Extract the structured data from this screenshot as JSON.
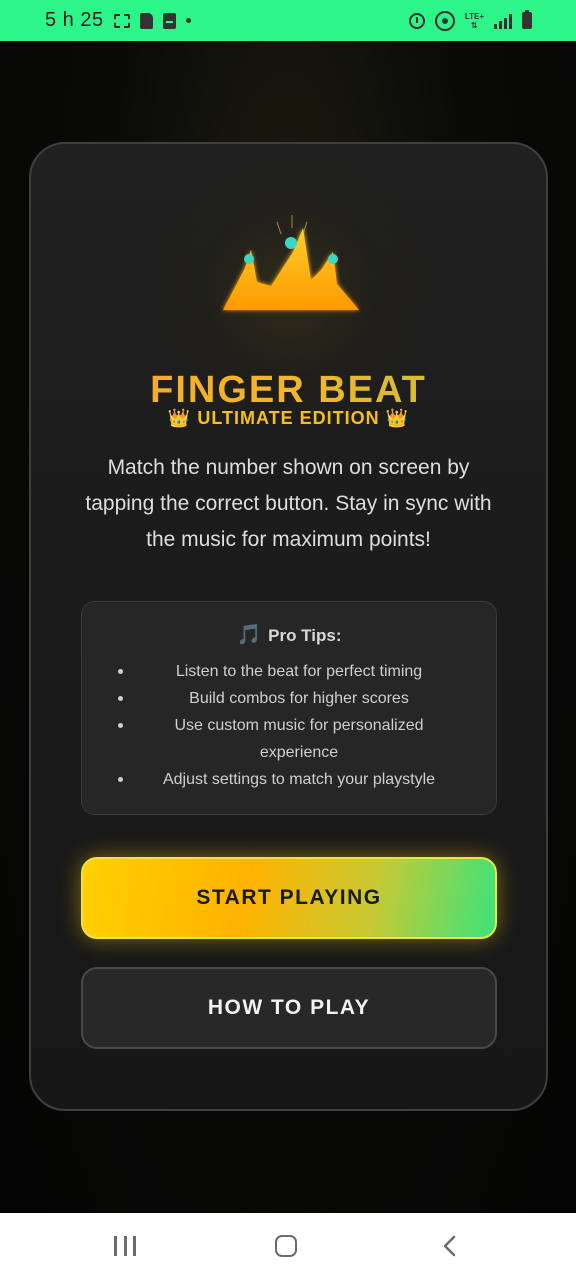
{
  "status_bar": {
    "time": "5 h 25",
    "icons_left": [
      "screenshot-icon",
      "sd-card-icon",
      "pdf-icon",
      "notification-dot-icon"
    ],
    "icons_right": [
      "alarm-icon",
      "hotspot-icon",
      "lte-icon",
      "signal-icon",
      "battery-icon"
    ],
    "network_label": "LTE+"
  },
  "card": {
    "logo_icon": "crown-mountain-logo-icon",
    "title": "FINGER BEAT",
    "subtitle_crown": "👑",
    "subtitle": "ULTIMATE EDITION",
    "description": "Match the number shown on screen by tapping the correct button. Stay in sync with the music for maximum points!",
    "tips": {
      "icon": "🎵",
      "title": "Pro Tips:",
      "items": [
        "Listen to the beat for perfect timing",
        "Build combos for higher scores",
        "Use custom music for personalized experience",
        "Adjust settings to match your playstyle"
      ]
    },
    "start_button": "START PLAYING",
    "how_button": "HOW TO PLAY"
  },
  "nav_bar": {
    "icons": [
      "recent-apps-icon",
      "home-icon",
      "back-icon"
    ]
  },
  "colors": {
    "status_bar": "#2ef58a",
    "title": "#f5a623",
    "accent_gold": "#ffd000",
    "accent_green": "#3ce37a",
    "card_bg": "#1e1e1e"
  }
}
